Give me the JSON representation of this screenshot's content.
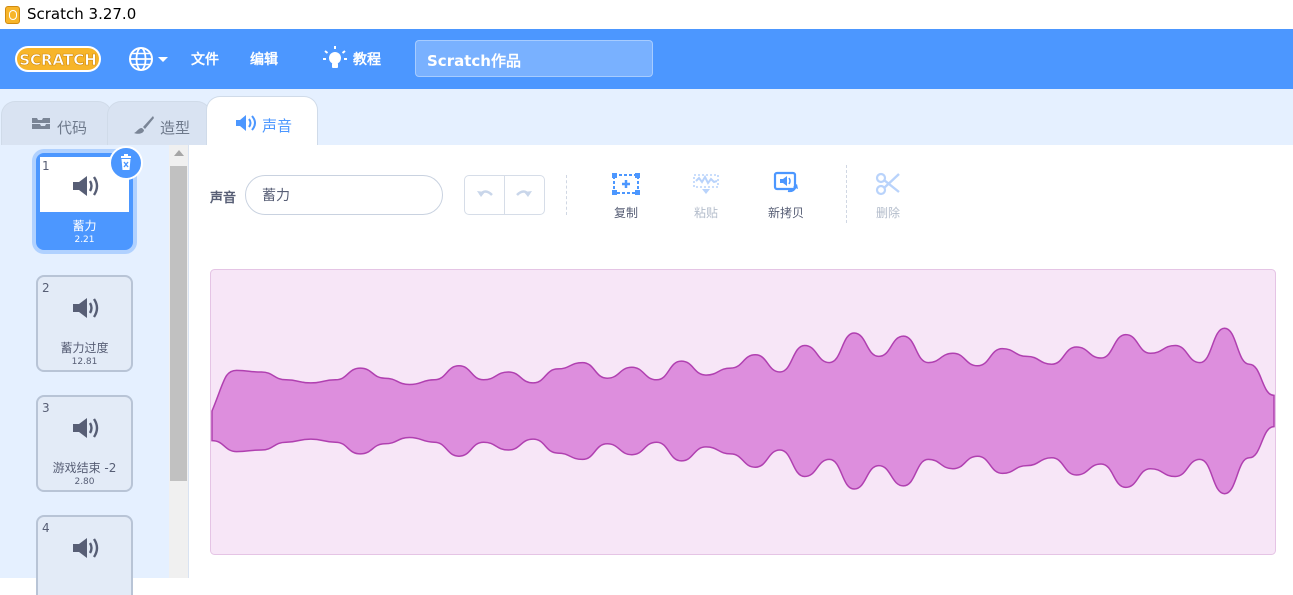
{
  "window": {
    "title": "Scratch 3.27.0"
  },
  "menubar": {
    "logo_text": "SCRATCH",
    "file_label": "文件",
    "edit_label": "编辑",
    "tutorials_label": "教程",
    "project_title": "Scratch作品"
  },
  "tabs": [
    {
      "label": "代码",
      "icon": "code-icon",
      "active": false
    },
    {
      "label": "造型",
      "icon": "brush-icon",
      "active": false
    },
    {
      "label": "声音",
      "icon": "speaker-icon",
      "active": true
    }
  ],
  "sounds": [
    {
      "number": "1",
      "name": "蓄力",
      "duration": "2.21",
      "selected": true
    },
    {
      "number": "2",
      "name": "蓄力过度",
      "duration": "12.81",
      "selected": false
    },
    {
      "number": "3",
      "name": "游戏结束 -2",
      "duration": "2.80",
      "selected": false
    },
    {
      "number": "4",
      "name": "",
      "duration": "",
      "selected": false
    }
  ],
  "editor": {
    "sound_label": "声音",
    "sound_name_value": "蓄力",
    "tools": {
      "copy_label": "复制",
      "paste_label": "粘贴",
      "copy_to_new_label": "新拷贝",
      "delete_label": "删除"
    },
    "paste_enabled": false,
    "delete_enabled": false,
    "undo_enabled": false,
    "redo_enabled": false
  },
  "colors": {
    "accent": "#4c97ff",
    "menubar": "#4c97ff",
    "tabstrip": "#e5f0ff",
    "waveform_fill": "#dd8edd",
    "waveform_stroke": "#b040b0",
    "waveform_bg": "#f7e6f7"
  },
  "waveform_envelope": [
    0.38,
    0.52,
    0.5,
    0.4,
    0.36,
    0.4,
    0.55,
    0.42,
    0.34,
    0.4,
    0.58,
    0.4,
    0.5,
    0.36,
    0.54,
    0.62,
    0.42,
    0.56,
    0.4,
    0.64,
    0.46,
    0.55,
    0.72,
    0.5,
    0.84,
    0.62,
    1.0,
    0.7,
    0.96,
    0.62,
    0.74,
    0.58,
    0.8,
    0.7,
    0.6,
    0.82,
    0.68,
    0.98,
    0.74,
    0.84,
    0.62,
    1.06,
    0.6,
    0.2
  ]
}
